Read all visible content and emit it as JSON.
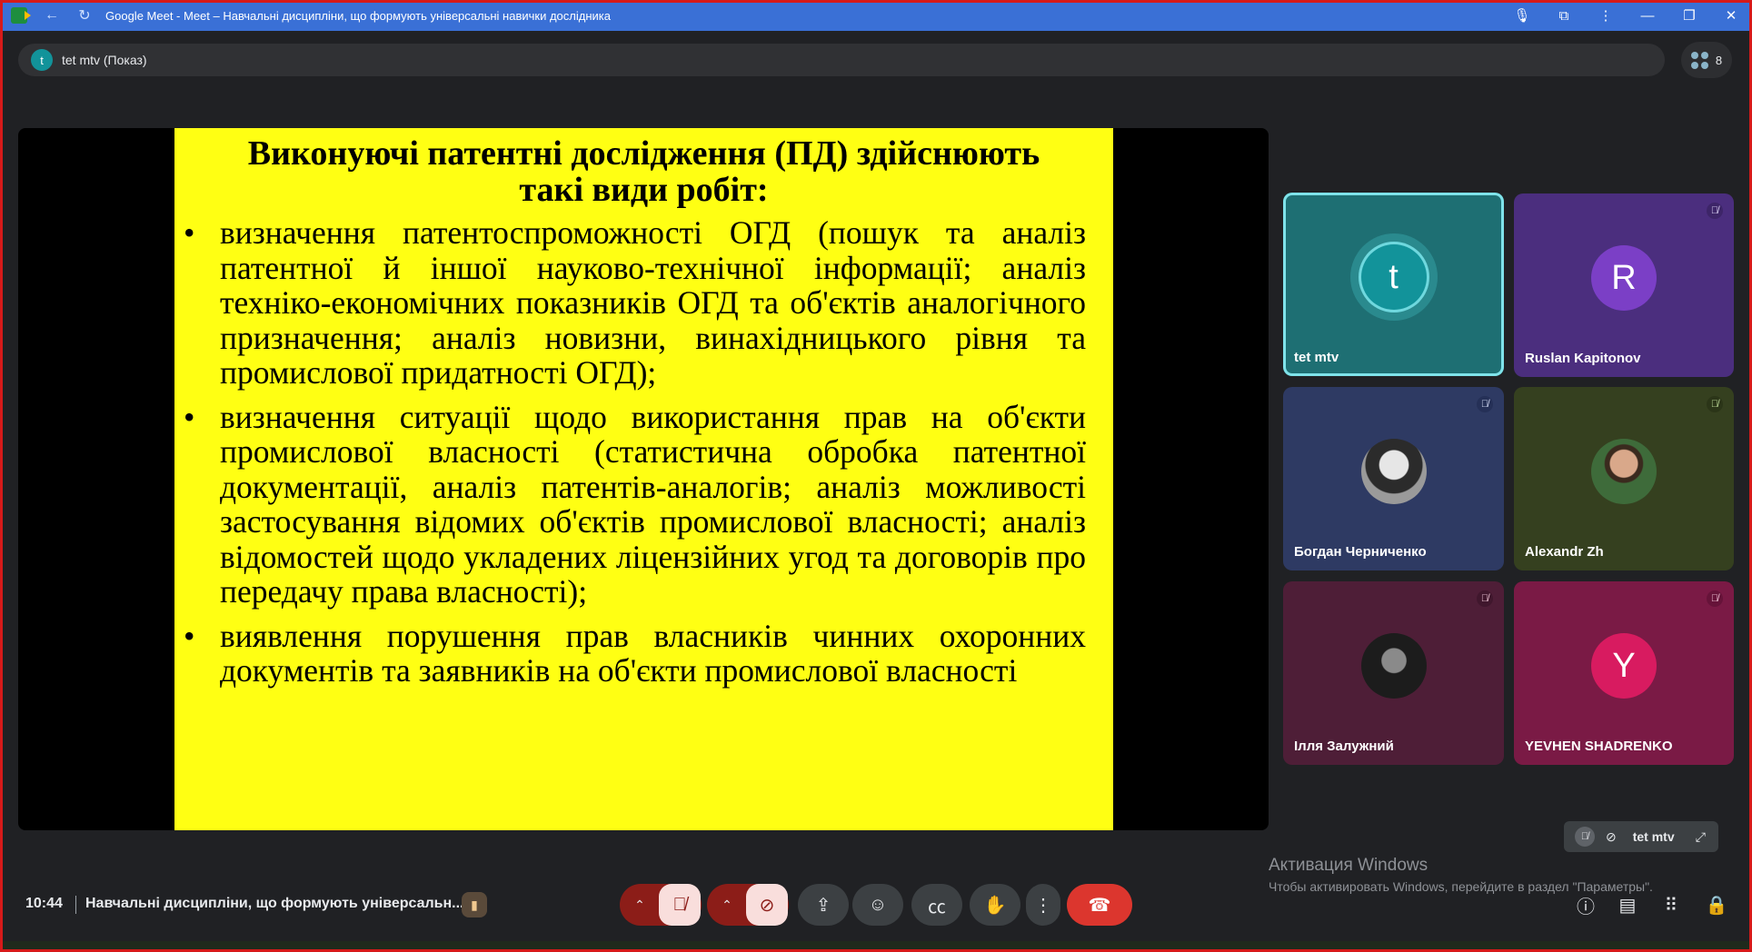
{
  "window": {
    "title": "Google Meet - Meet – Навчальні дисципліни, що формують універсальні навички дослідника"
  },
  "presenter": {
    "avatar_letter": "t",
    "label": "tet mtv (Показ)"
  },
  "people": {
    "count": "8"
  },
  "slide": {
    "title_line1": "Виконуючі патентні дослідження (ПД) здійснюють",
    "title_line2": "такі види робіт:",
    "bullet": "•",
    "items": [
      "визначення патентоспроможності ОГД (пошук та аналіз патентної й іншої науково-технічної інформації; аналіз техніко-економічних показників ОГД та об'єктів аналогічного призначення; аналіз новизни, винахідницького рівня та промислової придатності ОГД);",
      "визначення ситуації щодо використання прав на об'єкти промислової власності (статистична обробка патентної документації, аналіз патентів-аналогів; аналіз можливості застосування відомих об'єктів промислової власності; аналіз відомостей щодо укладених ліцензійних угод та договорів про передачу права власності);",
      "виявлення порушення прав власників чинних охоронних документів та заявників на об'єкти промислової власності"
    ]
  },
  "participants": [
    {
      "name": "tet mtv",
      "letter": "t",
      "muted": false
    },
    {
      "name": "Ruslan Kapitonov",
      "letter": "R",
      "muted": true
    },
    {
      "name": "Богдан Черниченко",
      "letter": "",
      "muted": true
    },
    {
      "name": "Alexandr Zh",
      "letter": "",
      "muted": false
    },
    {
      "name": "Ілля Залужний",
      "letter": "",
      "muted": true
    },
    {
      "name": "YEVHEN SHADRENKO",
      "letter": "Y",
      "muted": true
    }
  ],
  "self_view": {
    "name": "tet mtv"
  },
  "activation": {
    "line1": "Активация Windows",
    "line2": "Чтобы активировать Windows, перейдите в раздел \"Параметры\"."
  },
  "bottom": {
    "time": "10:44",
    "meeting_title": "Навчальні дисципліни, що формують універсальн..."
  },
  "colors": {
    "slide_bg": "#ffff13",
    "end_call": "#dc362e",
    "tile_active_border": "#7fe3ea"
  }
}
